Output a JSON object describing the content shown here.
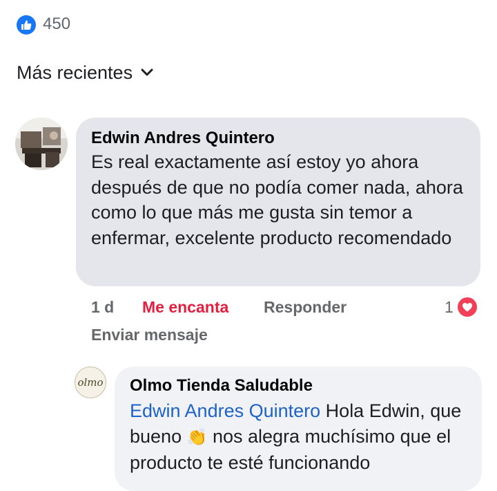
{
  "reactions": {
    "icon": "like-icon",
    "count": "450"
  },
  "sort": {
    "label": "Más recientes",
    "icon": "chevron-down-icon"
  },
  "comments": [
    {
      "author": "Edwin Andres Quintero",
      "text": "Es real exactamente así estoy yo ahora después de que no podía comer nada, ahora como lo que más me gusta sin temor a enfermar, excelente producto recomendado",
      "time": "1 d",
      "reaction_label": "Me encanta",
      "reply_label": "Responder",
      "reaction_count": "1",
      "reaction_icon": "heart-icon",
      "send_message_label": "Enviar mensaje"
    },
    {
      "author": "Olmo Tienda Saludable",
      "avatar_logo_text": "olmo",
      "mention": "Edwin Andres Quintero",
      "text_part1": " Hola Edwin, que bueno ",
      "emoji": "👏",
      "text_part2": " nos alegra muchísimo que el producto te esté funcionando"
    }
  ],
  "colors": {
    "like_blue": "#1877f2",
    "love_red": "#e41e3f",
    "mention_blue": "#1d62c9",
    "bubble_gray": "#e4e6eb",
    "meta_gray": "#65676b"
  }
}
